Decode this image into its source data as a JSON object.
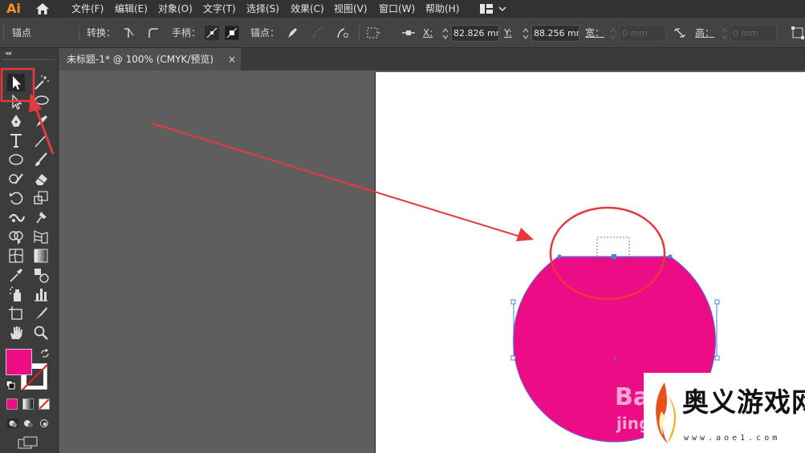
{
  "app": {
    "logo": "Ai"
  },
  "menu": {
    "items": [
      "文件(F)",
      "编辑(E)",
      "对象(O)",
      "文字(T)",
      "选择(S)",
      "效果(C)",
      "视图(V)",
      "窗口(W)",
      "帮助(H)"
    ]
  },
  "control_bar": {
    "anchor_label": "锚点",
    "convert_label": "转换：",
    "handle_label": "手柄：",
    "anchor_points_label": "锚点：",
    "x_label": "X:",
    "x_value": "82.826 mm",
    "y_label": "Y:",
    "y_value": "88.256 mm",
    "width_label": "宽：",
    "width_value": "0 mm",
    "height_label": "高：",
    "height_value": "0 mm"
  },
  "document": {
    "tab_title": "未标题-1* @ 100% (CMYK/预览)",
    "close_glyph": "×"
  },
  "artwork": {
    "fill_color": "#ec0c86",
    "selection_color": "#4a7fe3",
    "annotation_color": "#e8383d"
  },
  "toolbar": {
    "collapse_glyph": "◂◂",
    "tools": [
      "selection-tool",
      "magic-wand-tool",
      "direct-selection-tool",
      "lasso-tool",
      "pen-tool",
      "curvature-tool",
      "type-tool",
      "line-tool",
      "ellipse-tool",
      "paintbrush-tool",
      "shaper-tool",
      "eraser-tool",
      "rotate-tool",
      "scale-tool",
      "width-tool",
      "pin-tool",
      "shape-builder-tool",
      "perspective-grid-tool",
      "mesh-tool",
      "gradient-tool",
      "eyedropper-tool",
      "blend-tool",
      "symbol-sprayer-tool",
      "column-graph-tool",
      "artboard-tool",
      "slice-tool",
      "hand-tool",
      "zoom-tool"
    ],
    "fill_color": "#ec0c86"
  },
  "watermark": {
    "title": "奥义游戏网",
    "url": "www.aoe1.com",
    "ghost_text_1": "Ba",
    "ghost_text_2": "jing"
  }
}
